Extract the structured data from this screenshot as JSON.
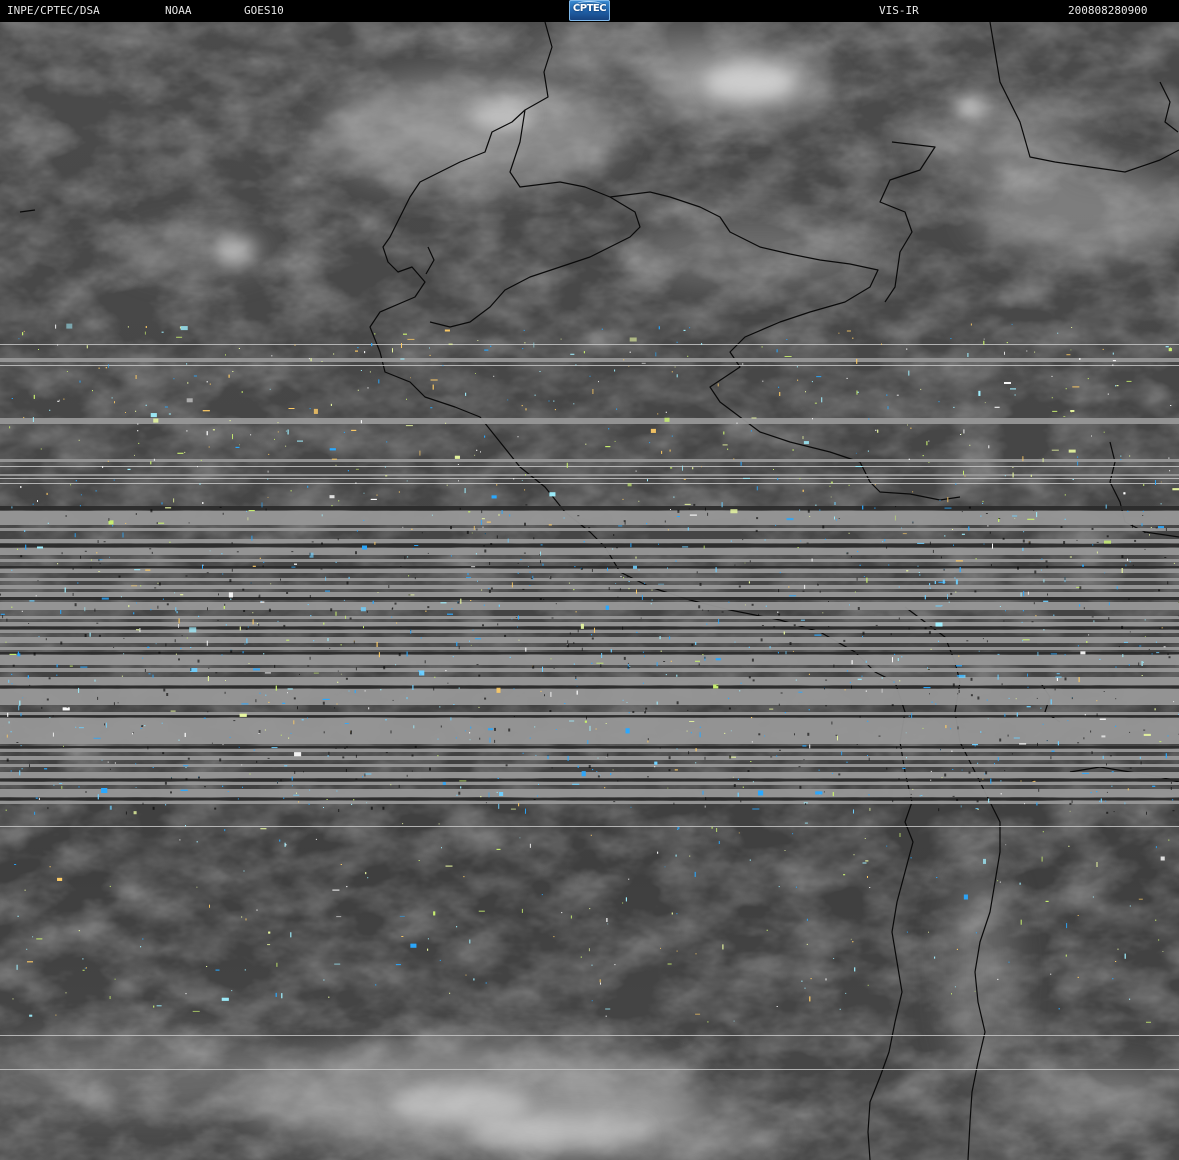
{
  "header": {
    "source": "INPE/CPTEC/DSA",
    "agency": "NOAA",
    "satellite": "GOES10",
    "channel": "VIS-IR",
    "datetime": "200808280900",
    "logo_text": "CPTEC"
  },
  "colors": {
    "background": "#000000",
    "header_text": "#e8e8e8",
    "logo_blue": "#1f5fa6",
    "earth_gray": "#444444",
    "cloud_light": "#cfcfcf",
    "scanline_gray": "#979797",
    "border_line": "#000000",
    "noise_green": "#c8f070",
    "noise_blue": "#2aa8ff"
  }
}
